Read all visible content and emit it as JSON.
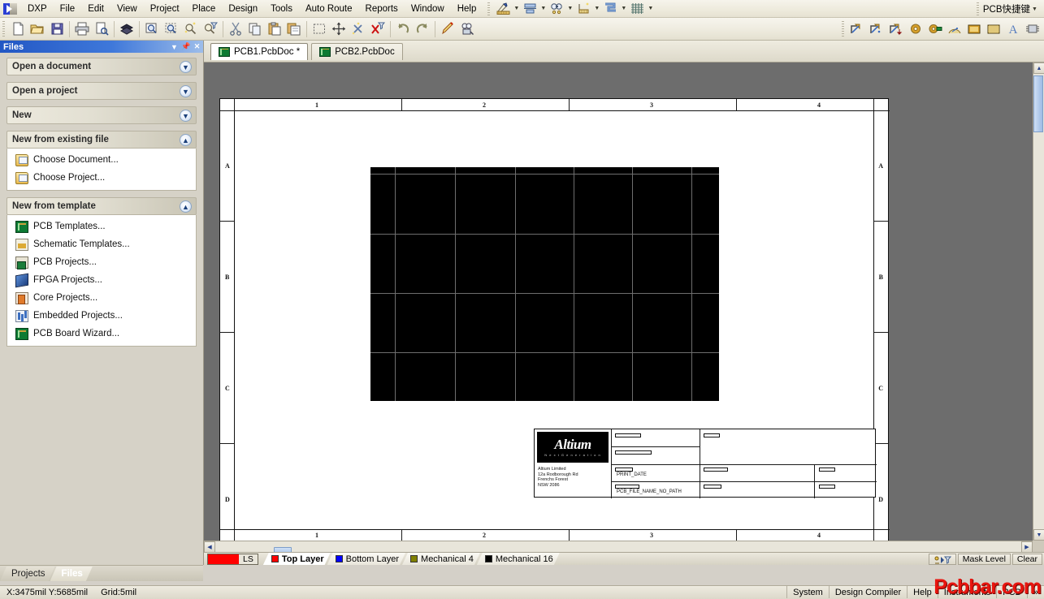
{
  "app": {
    "logo_name": "dxp-logo",
    "right_button": "PCB快捷键"
  },
  "menubar": {
    "items": [
      {
        "label": "DXP",
        "name": "menu-dxp"
      },
      {
        "label": "File",
        "name": "menu-file"
      },
      {
        "label": "Edit",
        "name": "menu-edit"
      },
      {
        "label": "View",
        "name": "menu-view"
      },
      {
        "label": "Project",
        "name": "menu-project"
      },
      {
        "label": "Place",
        "name": "menu-place"
      },
      {
        "label": "Design",
        "name": "menu-design"
      },
      {
        "label": "Tools",
        "name": "menu-tools"
      },
      {
        "label": "Auto Route",
        "name": "menu-auto-route"
      },
      {
        "label": "Reports",
        "name": "menu-reports"
      },
      {
        "label": "Window",
        "name": "menu-window"
      },
      {
        "label": "Help",
        "name": "menu-help"
      }
    ],
    "dropdown_tools": [
      "draw-tools-icon",
      "align-icon",
      "find-icon",
      "dimension-icon",
      "route-icon",
      "grid-icon"
    ]
  },
  "toolbar": {
    "left_icons": [
      "new-document-icon",
      "open-document-icon",
      "save-icon",
      "print-icon",
      "print-preview-icon",
      "layer-stack-icon",
      "zoom-document-icon",
      "zoom-area-icon",
      "zoom-selected-icon",
      "zoom-filtered-icon",
      "cut-icon",
      "copy-icon",
      "paste-icon",
      "paste-special-icon",
      "select-area-icon",
      "move-icon",
      "deselect-all-icon",
      "clear-filter-icon",
      "undo-icon",
      "redo-icon",
      "highlight-icon",
      "browse-components-icon"
    ],
    "right_icons": [
      "place-track-icon",
      "place-line-icon",
      "place-interactive-route-icon",
      "place-pad-icon",
      "place-via-icon",
      "place-arc-icon",
      "place-fill-icon",
      "place-polygon-icon",
      "place-string-icon",
      "place-component-icon"
    ]
  },
  "files_panel": {
    "title": "Files",
    "title_buttons": [
      "dropdown-icon",
      "pin-icon",
      "close-icon"
    ],
    "groups": [
      {
        "name": "open-a-document",
        "header": "Open a document",
        "collapsed": true,
        "chevron": "▼",
        "items": []
      },
      {
        "name": "open-a-project",
        "header": "Open a project",
        "collapsed": true,
        "chevron": "▼",
        "items": []
      },
      {
        "name": "new",
        "header": "New",
        "collapsed": true,
        "chevron": "▼",
        "items": []
      },
      {
        "name": "new-from-existing-file",
        "header": "New from existing file",
        "collapsed": false,
        "chevron": "▲",
        "items": [
          {
            "label": "Choose Document...",
            "icon": "ic-folder",
            "name": "choose-document"
          },
          {
            "label": "Choose Project...",
            "icon": "ic-folder",
            "name": "choose-project"
          }
        ]
      },
      {
        "name": "new-from-template",
        "header": "New from template",
        "collapsed": false,
        "chevron": "▲",
        "items": [
          {
            "label": "PCB Templates...",
            "icon": "ic-pcb",
            "name": "pcb-templates"
          },
          {
            "label": "Schematic Templates...",
            "icon": "ic-sch",
            "name": "schematic-templates"
          },
          {
            "label": "PCB Projects...",
            "icon": "ic-pcbprj",
            "name": "pcb-projects"
          },
          {
            "label": "FPGA Projects...",
            "icon": "ic-fpga",
            "name": "fpga-projects"
          },
          {
            "label": "Core Projects...",
            "icon": "ic-core",
            "name": "core-projects"
          },
          {
            "label": "Embedded Projects...",
            "icon": "ic-emb",
            "name": "embedded-projects"
          },
          {
            "label": "PCB Board Wizard...",
            "icon": "ic-pcb",
            "name": "pcb-board-wizard"
          }
        ]
      }
    ],
    "bottom_tabs": [
      {
        "label": "Projects",
        "active": false,
        "name": "panel-tab-projects"
      },
      {
        "label": "Files",
        "active": true,
        "name": "panel-tab-files"
      }
    ]
  },
  "document_tabs": [
    {
      "label": "PCB1.PcbDoc *",
      "active": true,
      "name": "doc-tab-pcb1"
    },
    {
      "label": "PCB2.PcbDoc",
      "active": false,
      "name": "doc-tab-pcb2"
    }
  ],
  "sheet": {
    "column_labels": [
      "1",
      "2",
      "3",
      "4"
    ],
    "row_labels": [
      "A",
      "B",
      "C",
      "D"
    ],
    "title_block": {
      "logo_text": "Altium",
      "logo_subtext": "N e x t   G e n e r a t i o n",
      "address": "Altium Limited\n12a Rodborough Rd\nFrenchs Forest\nNSW 2086",
      "field_print_date": "PRINT_DATE",
      "field_file_name": "PCB_FILE_NAME_NO_PATH"
    }
  },
  "layer_bar": {
    "ls_button": "LS",
    "ls_color": "#ff0000",
    "tabs": [
      {
        "label": "Top Layer",
        "color": "#ff0000",
        "active": true,
        "name": "layer-tab-top-layer"
      },
      {
        "label": "Bottom Layer",
        "color": "#0000ff",
        "active": false,
        "name": "layer-tab-bottom-layer"
      },
      {
        "label": "Mechanical 4",
        "color": "#808000",
        "active": false,
        "name": "layer-tab-mechanical-4"
      },
      {
        "label": "Mechanical 16",
        "color": "#000000",
        "active": false,
        "name": "layer-tab-mechanical-16"
      }
    ],
    "right_buttons": [
      {
        "label": "Mask Level",
        "name": "mask-level-button"
      },
      {
        "label": "Clear",
        "name": "clear-button"
      }
    ],
    "filter_icon": "mask-filter-icon"
  },
  "status_bar": {
    "coordinates": "X:3475mil Y:5685mil",
    "grid": "Grid:5mil",
    "panels": [
      {
        "label": "System",
        "name": "status-system"
      },
      {
        "label": "Design Compiler",
        "name": "status-design-compiler"
      },
      {
        "label": "Help",
        "name": "status-help"
      },
      {
        "label": "Instruments",
        "name": "status-instruments"
      },
      {
        "label": "PCB",
        "name": "status-pcb"
      },
      {
        "label": "»",
        "name": "status-more"
      }
    ]
  },
  "watermark": {
    "text": "Pcbbar.com",
    "color": "#e8150f"
  }
}
